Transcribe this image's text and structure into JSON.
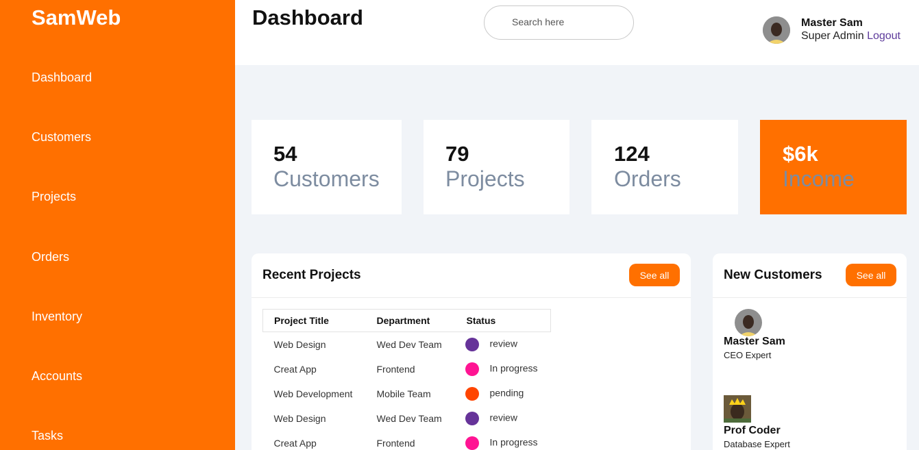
{
  "brand": "SamWeb",
  "sidebar": {
    "items": [
      {
        "label": "Dashboard"
      },
      {
        "label": "Customers"
      },
      {
        "label": "Projects"
      },
      {
        "label": "Orders"
      },
      {
        "label": "Inventory"
      },
      {
        "label": "Accounts"
      },
      {
        "label": "Tasks"
      }
    ]
  },
  "header": {
    "title": "Dashboard",
    "search_placeholder": "Search here",
    "user_name": "Master Sam",
    "user_role": "Super Admin",
    "logout_label": "Logout"
  },
  "stats": [
    {
      "value": "54",
      "label": "Customers"
    },
    {
      "value": "79",
      "label": "Projects"
    },
    {
      "value": "124",
      "label": "Orders"
    },
    {
      "value": "$6k",
      "label": "Income"
    }
  ],
  "recent_projects": {
    "title": "Recent Projects",
    "see_all_label": "See all",
    "columns": [
      "Project Title",
      "Department",
      "Status"
    ],
    "rows": [
      {
        "title": "Web Design",
        "department": "Wed Dev Team",
        "status": "review",
        "status_color": "#663399"
      },
      {
        "title": "Creat App",
        "department": "Frontend",
        "status": "In progress",
        "status_color": "#ff1493"
      },
      {
        "title": "Web Development",
        "department": "Mobile Team",
        "status": "pending",
        "status_color": "#ff4500"
      },
      {
        "title": "Web Design",
        "department": "Wed Dev Team",
        "status": "review",
        "status_color": "#663399"
      },
      {
        "title": "Creat App",
        "department": "Frontend",
        "status": "In progress",
        "status_color": "#ff1493"
      }
    ]
  },
  "new_customers": {
    "title": "New Customers",
    "see_all_label": "See all",
    "items": [
      {
        "name": "Master Sam",
        "role": "CEO Expert"
      },
      {
        "name": "Prof Coder",
        "role": "Database Expert"
      }
    ]
  },
  "colors": {
    "accent": "#ff7000",
    "background": "#f1f4f8",
    "muted_text": "#7d8ca0",
    "link": "#5d3a9b"
  }
}
